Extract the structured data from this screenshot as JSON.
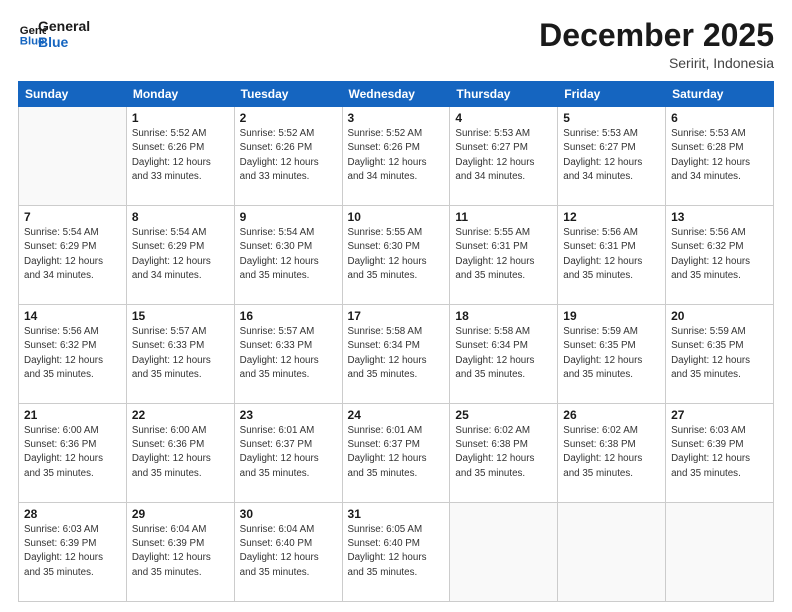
{
  "logo": {
    "line1": "General",
    "line2": "Blue"
  },
  "header": {
    "month": "December 2025",
    "location": "Seririt, Indonesia"
  },
  "weekdays": [
    "Sunday",
    "Monday",
    "Tuesday",
    "Wednesday",
    "Thursday",
    "Friday",
    "Saturday"
  ],
  "weeks": [
    [
      {
        "day": "",
        "info": ""
      },
      {
        "day": "1",
        "info": "Sunrise: 5:52 AM\nSunset: 6:26 PM\nDaylight: 12 hours\nand 33 minutes."
      },
      {
        "day": "2",
        "info": "Sunrise: 5:52 AM\nSunset: 6:26 PM\nDaylight: 12 hours\nand 33 minutes."
      },
      {
        "day": "3",
        "info": "Sunrise: 5:52 AM\nSunset: 6:26 PM\nDaylight: 12 hours\nand 34 minutes."
      },
      {
        "day": "4",
        "info": "Sunrise: 5:53 AM\nSunset: 6:27 PM\nDaylight: 12 hours\nand 34 minutes."
      },
      {
        "day": "5",
        "info": "Sunrise: 5:53 AM\nSunset: 6:27 PM\nDaylight: 12 hours\nand 34 minutes."
      },
      {
        "day": "6",
        "info": "Sunrise: 5:53 AM\nSunset: 6:28 PM\nDaylight: 12 hours\nand 34 minutes."
      }
    ],
    [
      {
        "day": "7",
        "info": "Sunrise: 5:54 AM\nSunset: 6:29 PM\nDaylight: 12 hours\nand 34 minutes."
      },
      {
        "day": "8",
        "info": "Sunrise: 5:54 AM\nSunset: 6:29 PM\nDaylight: 12 hours\nand 34 minutes."
      },
      {
        "day": "9",
        "info": "Sunrise: 5:54 AM\nSunset: 6:30 PM\nDaylight: 12 hours\nand 35 minutes."
      },
      {
        "day": "10",
        "info": "Sunrise: 5:55 AM\nSunset: 6:30 PM\nDaylight: 12 hours\nand 35 minutes."
      },
      {
        "day": "11",
        "info": "Sunrise: 5:55 AM\nSunset: 6:31 PM\nDaylight: 12 hours\nand 35 minutes."
      },
      {
        "day": "12",
        "info": "Sunrise: 5:56 AM\nSunset: 6:31 PM\nDaylight: 12 hours\nand 35 minutes."
      },
      {
        "day": "13",
        "info": "Sunrise: 5:56 AM\nSunset: 6:32 PM\nDaylight: 12 hours\nand 35 minutes."
      }
    ],
    [
      {
        "day": "14",
        "info": "Sunrise: 5:56 AM\nSunset: 6:32 PM\nDaylight: 12 hours\nand 35 minutes."
      },
      {
        "day": "15",
        "info": "Sunrise: 5:57 AM\nSunset: 6:33 PM\nDaylight: 12 hours\nand 35 minutes."
      },
      {
        "day": "16",
        "info": "Sunrise: 5:57 AM\nSunset: 6:33 PM\nDaylight: 12 hours\nand 35 minutes."
      },
      {
        "day": "17",
        "info": "Sunrise: 5:58 AM\nSunset: 6:34 PM\nDaylight: 12 hours\nand 35 minutes."
      },
      {
        "day": "18",
        "info": "Sunrise: 5:58 AM\nSunset: 6:34 PM\nDaylight: 12 hours\nand 35 minutes."
      },
      {
        "day": "19",
        "info": "Sunrise: 5:59 AM\nSunset: 6:35 PM\nDaylight: 12 hours\nand 35 minutes."
      },
      {
        "day": "20",
        "info": "Sunrise: 5:59 AM\nSunset: 6:35 PM\nDaylight: 12 hours\nand 35 minutes."
      }
    ],
    [
      {
        "day": "21",
        "info": "Sunrise: 6:00 AM\nSunset: 6:36 PM\nDaylight: 12 hours\nand 35 minutes."
      },
      {
        "day": "22",
        "info": "Sunrise: 6:00 AM\nSunset: 6:36 PM\nDaylight: 12 hours\nand 35 minutes."
      },
      {
        "day": "23",
        "info": "Sunrise: 6:01 AM\nSunset: 6:37 PM\nDaylight: 12 hours\nand 35 minutes."
      },
      {
        "day": "24",
        "info": "Sunrise: 6:01 AM\nSunset: 6:37 PM\nDaylight: 12 hours\nand 35 minutes."
      },
      {
        "day": "25",
        "info": "Sunrise: 6:02 AM\nSunset: 6:38 PM\nDaylight: 12 hours\nand 35 minutes."
      },
      {
        "day": "26",
        "info": "Sunrise: 6:02 AM\nSunset: 6:38 PM\nDaylight: 12 hours\nand 35 minutes."
      },
      {
        "day": "27",
        "info": "Sunrise: 6:03 AM\nSunset: 6:39 PM\nDaylight: 12 hours\nand 35 minutes."
      }
    ],
    [
      {
        "day": "28",
        "info": "Sunrise: 6:03 AM\nSunset: 6:39 PM\nDaylight: 12 hours\nand 35 minutes."
      },
      {
        "day": "29",
        "info": "Sunrise: 6:04 AM\nSunset: 6:39 PM\nDaylight: 12 hours\nand 35 minutes."
      },
      {
        "day": "30",
        "info": "Sunrise: 6:04 AM\nSunset: 6:40 PM\nDaylight: 12 hours\nand 35 minutes."
      },
      {
        "day": "31",
        "info": "Sunrise: 6:05 AM\nSunset: 6:40 PM\nDaylight: 12 hours\nand 35 minutes."
      },
      {
        "day": "",
        "info": ""
      },
      {
        "day": "",
        "info": ""
      },
      {
        "day": "",
        "info": ""
      }
    ]
  ]
}
